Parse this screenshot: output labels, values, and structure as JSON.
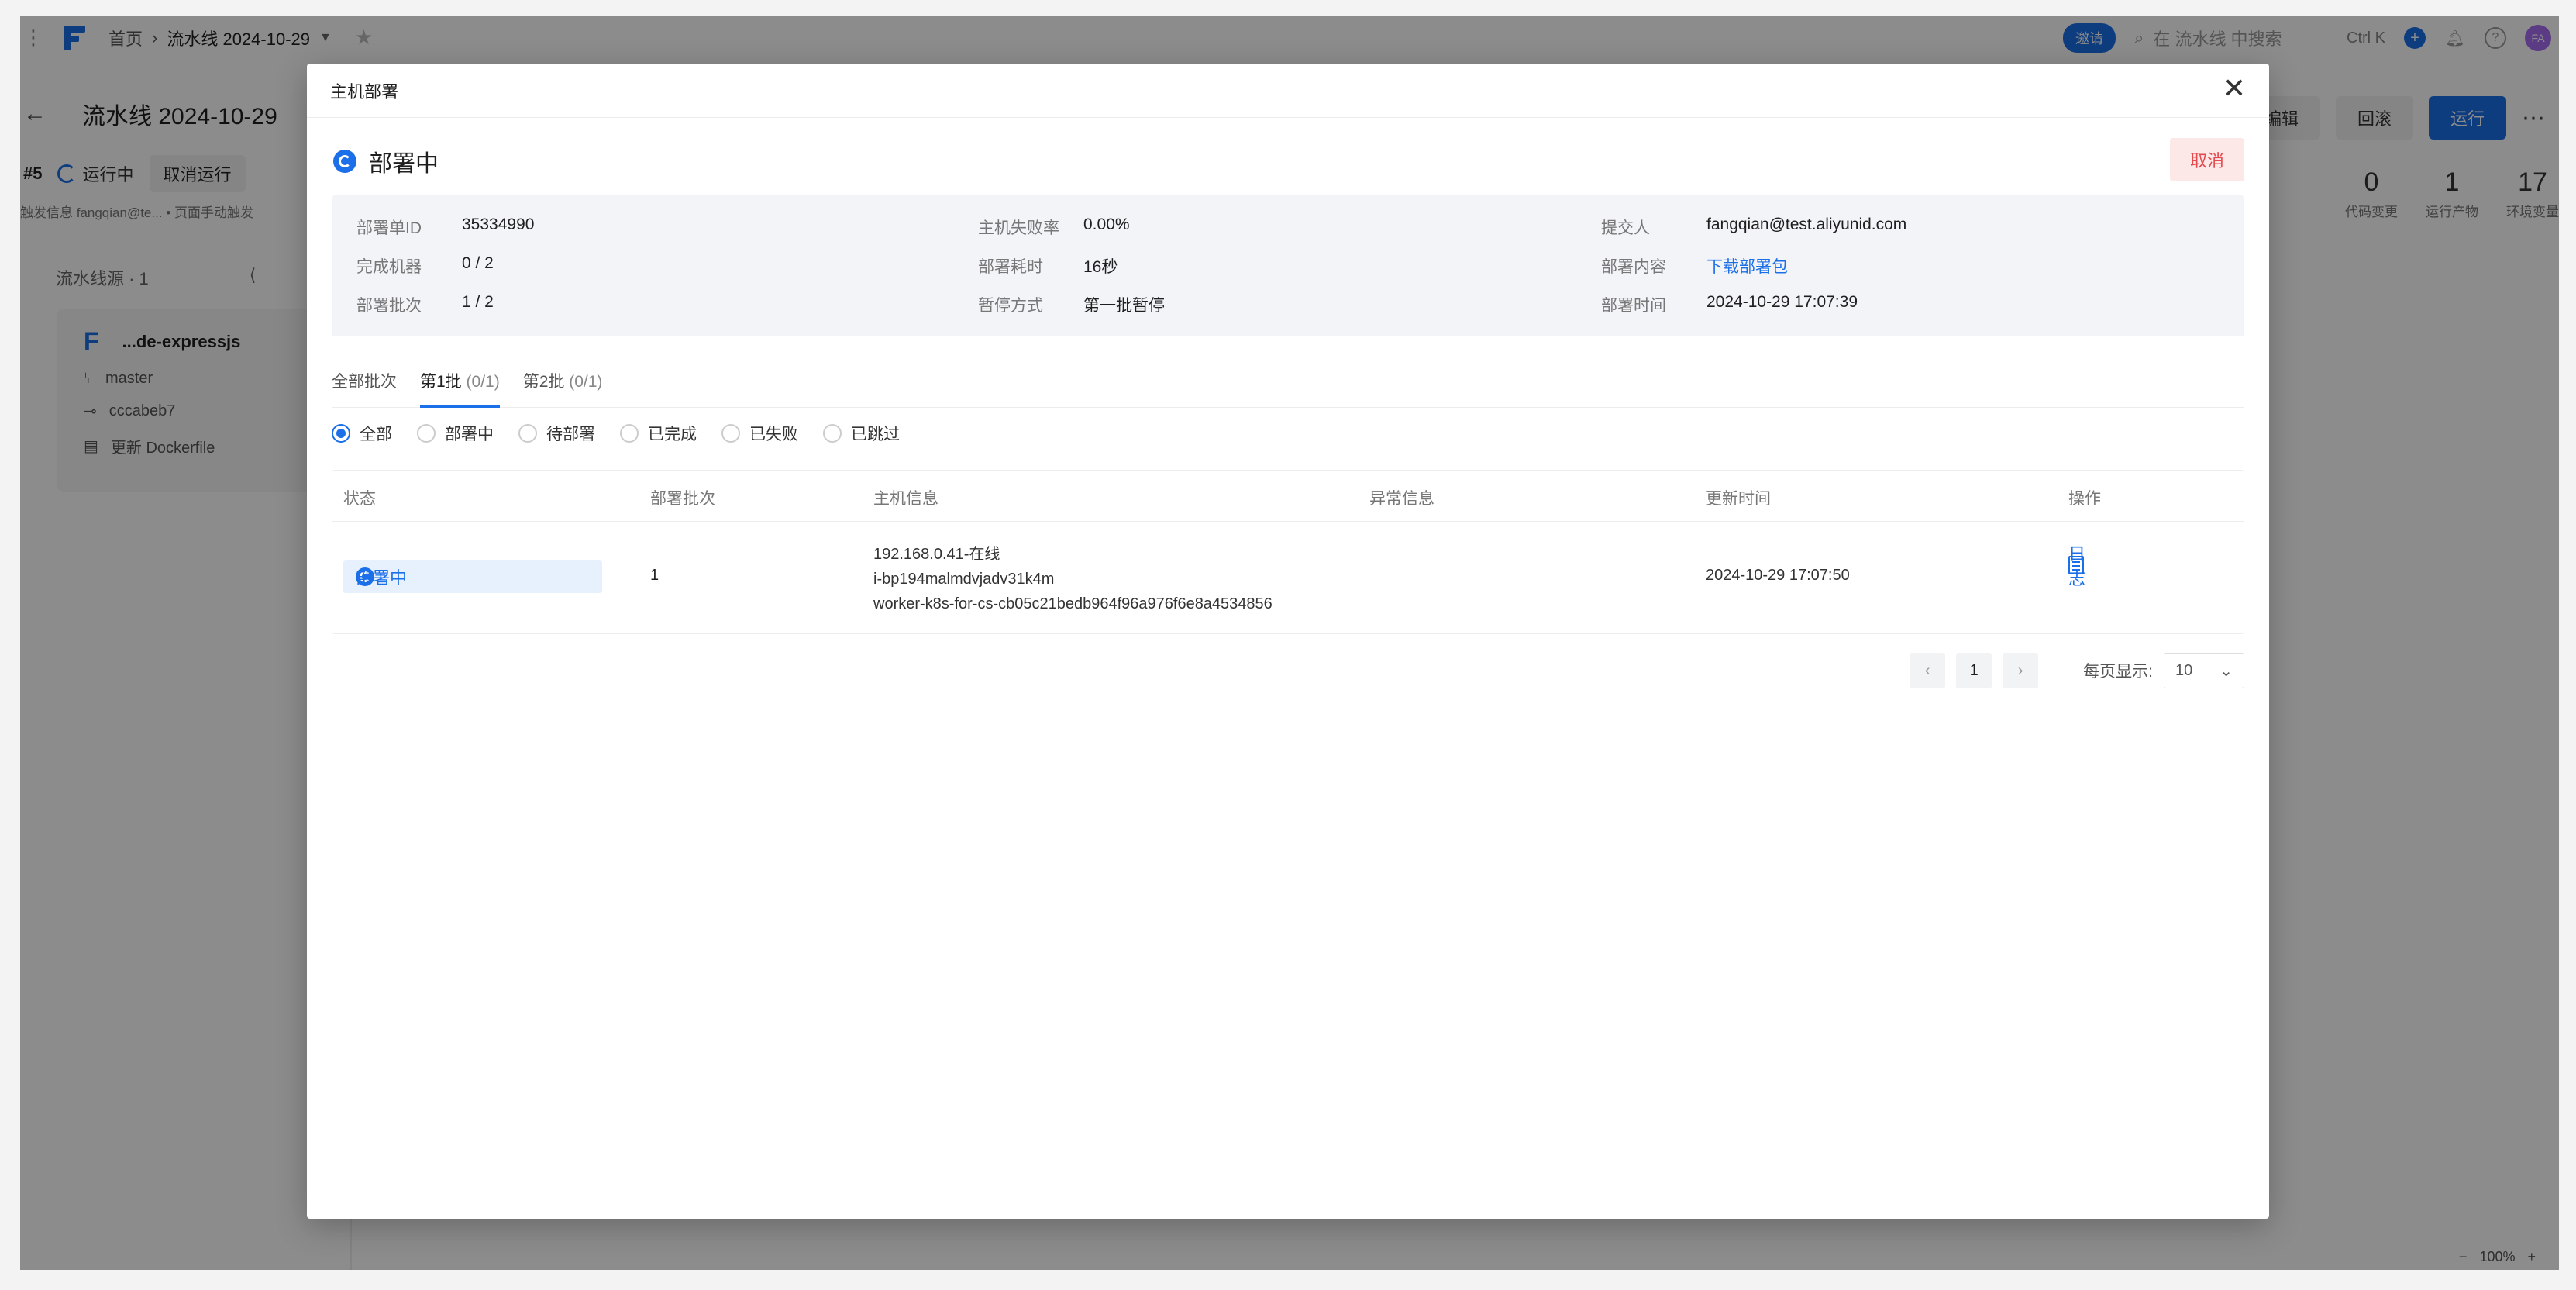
{
  "bg": {
    "breadcrumb_home": "首页",
    "breadcrumb_current": "流水线 2024-10-29",
    "invite": "邀请",
    "search_placeholder": "在 流水线 中搜索",
    "shortcut": "Ctrl K",
    "avatar_text": "FA",
    "page_title": "流水线 2024-10-29",
    "edit": "编辑",
    "rollback": "回滚",
    "run": "运行",
    "run_number": "#5",
    "run_status": "运行中",
    "cancel_run": "取消运行",
    "trigger_info": "触发信息  fangqian@te...  • 页面手动触发",
    "stats": [
      {
        "value": "0",
        "label": "代码变更"
      },
      {
        "value": "1",
        "label": "运行产物"
      },
      {
        "value": "17",
        "label": "环境变量"
      }
    ],
    "source_head": "流水线源 · 1",
    "repo": "...de-expressjs",
    "branch": "master",
    "commit": "cccabeb7",
    "commit_msg": "更新 Dockerfile",
    "zoom": "100%"
  },
  "modal": {
    "title": "主机部署",
    "status": "部署中",
    "cancel": "取消",
    "info": [
      {
        "k": "部署单ID",
        "v": "35334990"
      },
      {
        "k": "完成机器",
        "v": "0 / 2"
      },
      {
        "k": "部署批次",
        "v": "1 / 2"
      },
      {
        "k": "主机失败率",
        "v": "0.00%"
      },
      {
        "k": "部署耗时",
        "v": "16秒"
      },
      {
        "k": "暂停方式",
        "v": "第一批暂停"
      },
      {
        "k": "提交人",
        "v": "fangqian@test.aliyunid.com"
      },
      {
        "k": "部署内容",
        "v": "下载部署包"
      },
      {
        "k": "部署时间",
        "v": "2024-10-29 17:07:39"
      }
    ],
    "tabs": [
      {
        "label": "全部批次",
        "sub": ""
      },
      {
        "label": "第1批",
        "sub": "(0/1)"
      },
      {
        "label": "第2批",
        "sub": "(0/1)"
      }
    ],
    "filters": [
      "全部",
      "部署中",
      "待部署",
      "已完成",
      "已失败",
      "已跳过"
    ],
    "columns": [
      "状态",
      "部署批次",
      "主机信息",
      "异常信息",
      "更新时间",
      "操作"
    ],
    "rows": [
      {
        "state": "部署中",
        "batch": "1",
        "host_line1": "192.168.0.41-在线",
        "host_line2": "i-bp194malmdvjadv31k4m",
        "host_line3": "worker-k8s-for-cs-cb05c21bedb964f96a976f6e8a4534856",
        "error": "",
        "updated": "2024-10-29 17:07:50",
        "action": "日志"
      }
    ],
    "pager": {
      "current": "1",
      "page_size_label": "每页显示:",
      "page_size": "10"
    }
  }
}
